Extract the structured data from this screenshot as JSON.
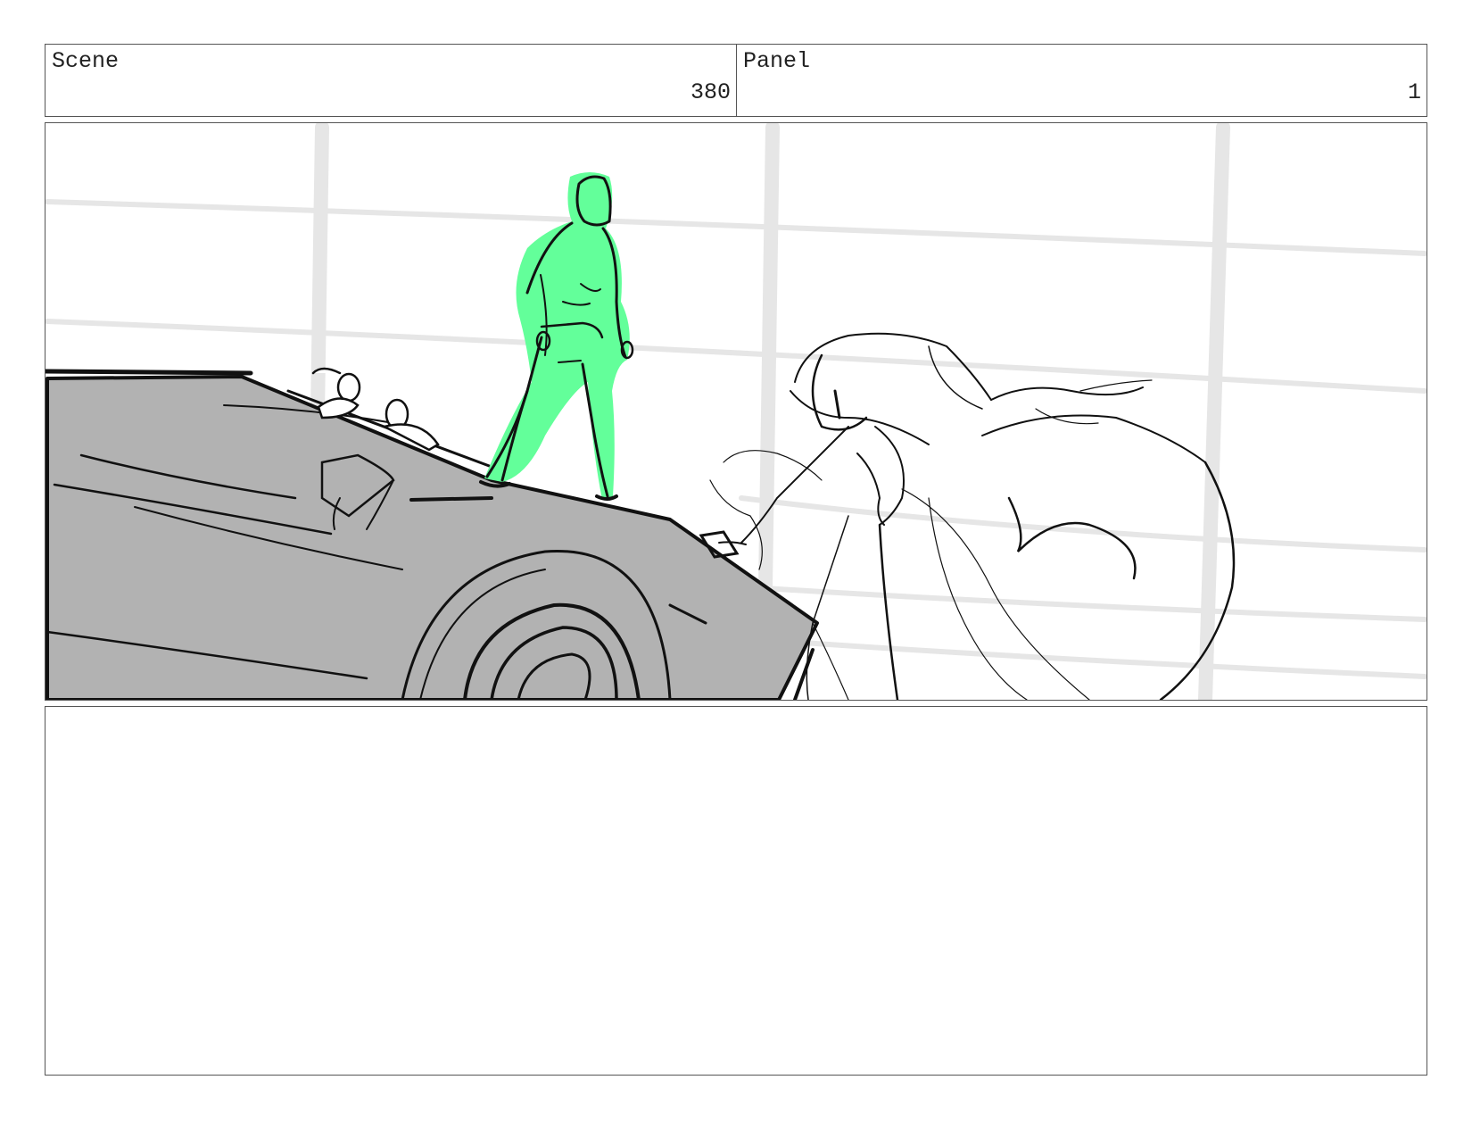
{
  "header": {
    "scene_label": "Scene",
    "scene_number": "380",
    "panel_label": "Panel",
    "panel_number": "1"
  },
  "colors": {
    "character_highlight": "#63ff9a",
    "vehicle_fill": "#b2b2b2",
    "line": "#111111"
  }
}
